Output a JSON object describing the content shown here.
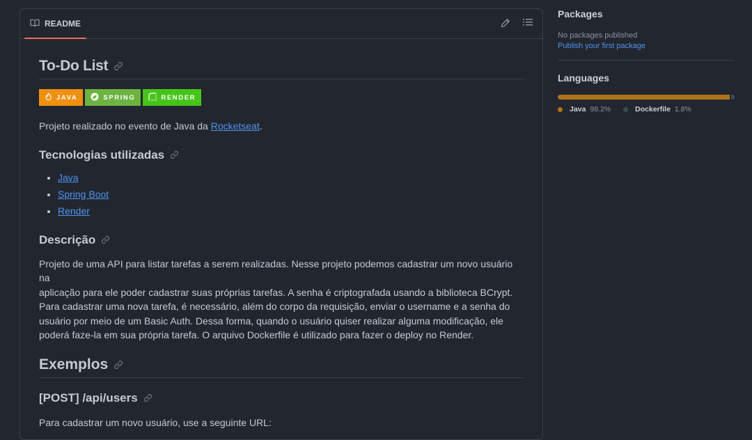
{
  "readme": {
    "tab_label": "README",
    "title": "To-Do List",
    "badges": [
      {
        "label": "JAVA",
        "color": "#f09010",
        "icon": "java-flame-icon"
      },
      {
        "label": "SPRING",
        "color": "#6db33f",
        "icon": "spring-leaf-icon"
      },
      {
        "label": "RENDER",
        "color": "#46c41a",
        "icon": "render-icon"
      }
    ],
    "intro_text": "Projeto realizado no evento de Java da ",
    "intro_link": "Rocketseat",
    "intro_end": ".",
    "tech_heading": "Tecnologias utilizadas",
    "tech_items": [
      "Java",
      "Spring Boot",
      "Render"
    ],
    "desc_heading": "Descrição",
    "desc_lines": [
      "Projeto de uma API para listar tarefas a serem realizadas. Nesse projeto podemos cadastrar um novo usuário na",
      "aplicação para ele poder cadastrar suas próprias tarefas. A senha é criptografada usando a biblioteca BCrypt.",
      "Para cadastrar uma nova tarefa, é necessário, além do corpo da requisição, enviar o username e a senha do",
      "usuário por meio de um Basic Auth. Dessa forma, quando o usuário quiser realizar alguma modificação, ele",
      "poderá faze-la em sua própria tarefa. O arquivo Dockerfile é utilizado para fazer o deploy no Render."
    ],
    "examples_heading": "Exemplos",
    "post_heading": "[POST] /api/users",
    "post_text": "Para cadastrar um novo usuário, use a seguinte URL:"
  },
  "sidebar": {
    "packages_title": "Packages",
    "packages_empty": "No packages published",
    "packages_link": "Publish your first package",
    "languages_title": "Languages",
    "languages": [
      {
        "name": "Java",
        "percent": "98.2%",
        "value": 98.2,
        "color": "#b07219"
      },
      {
        "name": "Dockerfile",
        "percent": "1.8%",
        "value": 1.8,
        "color": "#384d54"
      }
    ]
  }
}
